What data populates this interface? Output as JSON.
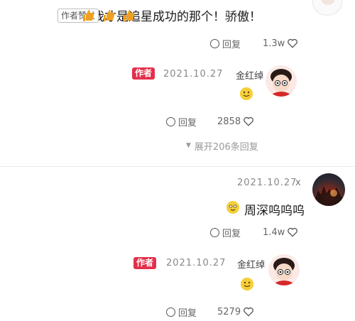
{
  "comment1": {
    "text": "我才是追星成功的那个！骄傲！",
    "badge": "作者赞过",
    "likes": "1.3w",
    "reply_label": "回复"
  },
  "reply1": {
    "name": "金红绰",
    "date": "2021.10.27",
    "author_tag": "作者",
    "likes": "2858",
    "reply_label": "回复",
    "expand_label": "展开206条回复"
  },
  "comment2": {
    "close": "x",
    "date": "2021.10.27",
    "text": "周深呜呜呜",
    "likes": "1.4w",
    "reply_label": "回复"
  },
  "reply2": {
    "name": "金红绰",
    "date": "2021.10.27",
    "author_tag": "作者",
    "likes": "5279",
    "reply_label": "回复"
  },
  "colors": {
    "author_tag": "#e3304a",
    "thumb": "#f0a020",
    "emoji": "#f5cf3a"
  }
}
